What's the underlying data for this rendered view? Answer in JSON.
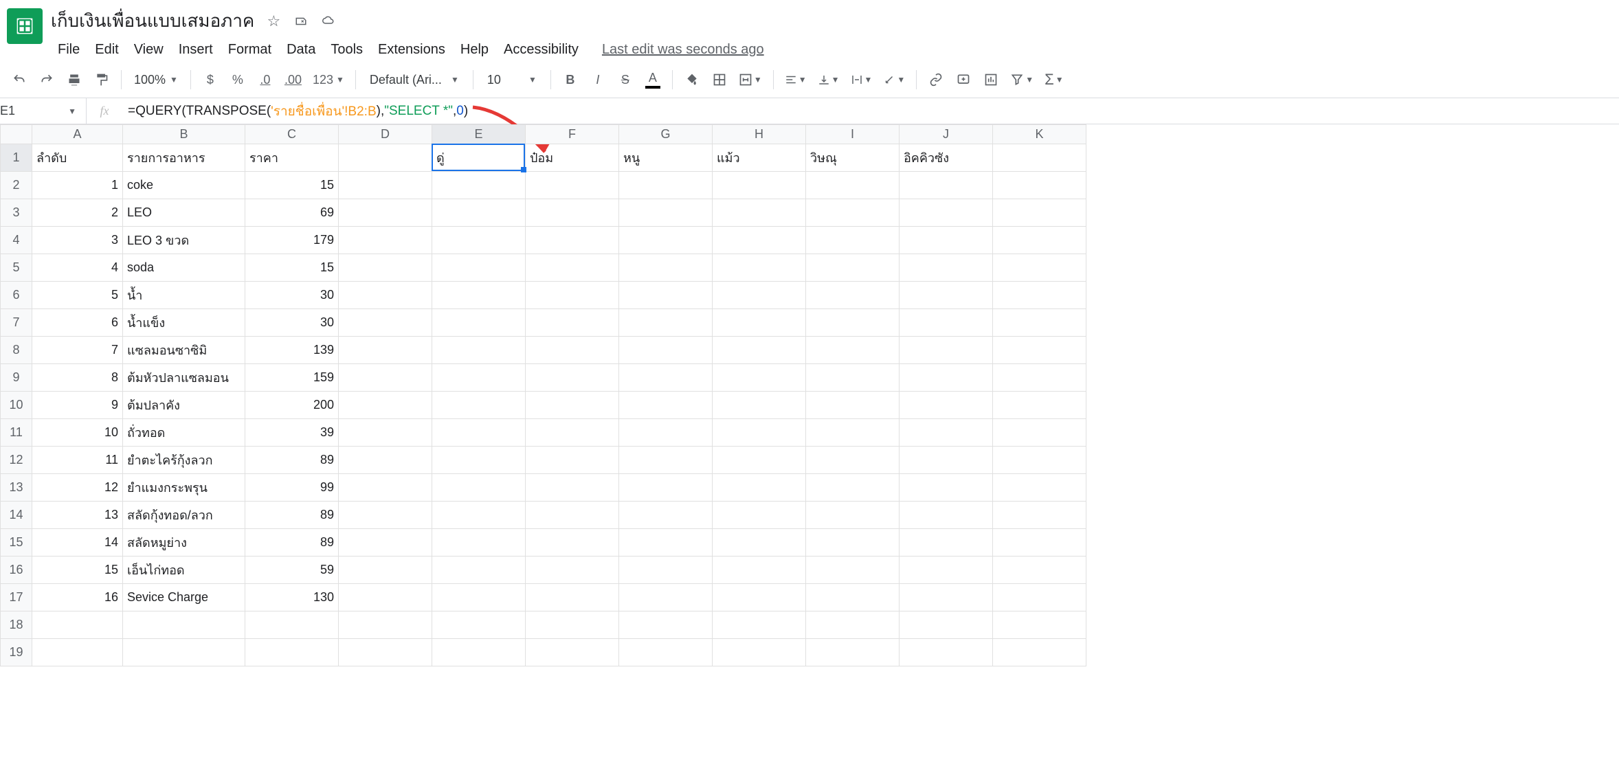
{
  "doc": {
    "title": "เก็บเงินเพื่อนแบบเสมอภาค"
  },
  "menu": {
    "file": "File",
    "edit": "Edit",
    "view": "View",
    "insert": "Insert",
    "format": "Format",
    "data": "Data",
    "tools": "Tools",
    "extensions": "Extensions",
    "help": "Help",
    "accessibility": "Accessibility",
    "last_edit": "Last edit was seconds ago"
  },
  "toolbar": {
    "zoom": "100%",
    "currency": "$",
    "percent": "%",
    "dec_dec": ".0",
    "inc_dec": ".00",
    "more_fmt": "123",
    "font": "Default (Ari...",
    "size": "10",
    "bold": "B",
    "italic": "I",
    "strike": "S",
    "textcolor": "A"
  },
  "formula_bar": {
    "cell_ref": "E1",
    "fn_open": "=QUERY(TRANSPOSE(",
    "ref": "'รายชื่อเพื่อน'!B2:B",
    "mid": "),",
    "str": "\"SELECT *\"",
    "comma": ",",
    "num": "0",
    "close": ")"
  },
  "columns": [
    "A",
    "B",
    "C",
    "D",
    "E",
    "F",
    "G",
    "H",
    "I",
    "J",
    "K"
  ],
  "selected_col": "E",
  "selected_row": 1,
  "header_row": {
    "A": "ลำดับ",
    "B": "รายการอาหาร",
    "C": "ราคา",
    "D": "",
    "E": "ดู่",
    "F": "ป๋อม",
    "G": "หนู",
    "H": "แม้ว",
    "I": "วิษณุ",
    "J": "อิคคิวซัง",
    "K": ""
  },
  "rows": [
    {
      "A": "1",
      "B": "coke",
      "C": "15"
    },
    {
      "A": "2",
      "B": "LEO",
      "C": "69"
    },
    {
      "A": "3",
      "B": "LEO 3 ขวด",
      "C": "179"
    },
    {
      "A": "4",
      "B": "soda",
      "C": "15"
    },
    {
      "A": "5",
      "B": "น้ำ",
      "C": "30"
    },
    {
      "A": "6",
      "B": "น้ำแข็ง",
      "C": "30"
    },
    {
      "A": "7",
      "B": "แซลมอนซาซิมิ",
      "C": "139"
    },
    {
      "A": "8",
      "B": "ต้มหัวปลาแซลมอน",
      "C": "159"
    },
    {
      "A": "9",
      "B": "ต้มปลาคัง",
      "C": "200"
    },
    {
      "A": "10",
      "B": "ถั่วทอด",
      "C": "39"
    },
    {
      "A": "11",
      "B": "ยำตะไคร้กุ้งลวก",
      "C": "89"
    },
    {
      "A": "12",
      "B": "ยำแมงกระพรุน",
      "C": "99"
    },
    {
      "A": "13",
      "B": "สลัดกุ้งทอด/ลวก",
      "C": "89"
    },
    {
      "A": "14",
      "B": "สลัดหมูย่าง",
      "C": "89"
    },
    {
      "A": "15",
      "B": "เอ็นไก่ทอด",
      "C": "59"
    },
    {
      "A": "16",
      "B": "Sevice Charge",
      "C": "130"
    }
  ],
  "empty_rows": [
    18,
    19
  ]
}
